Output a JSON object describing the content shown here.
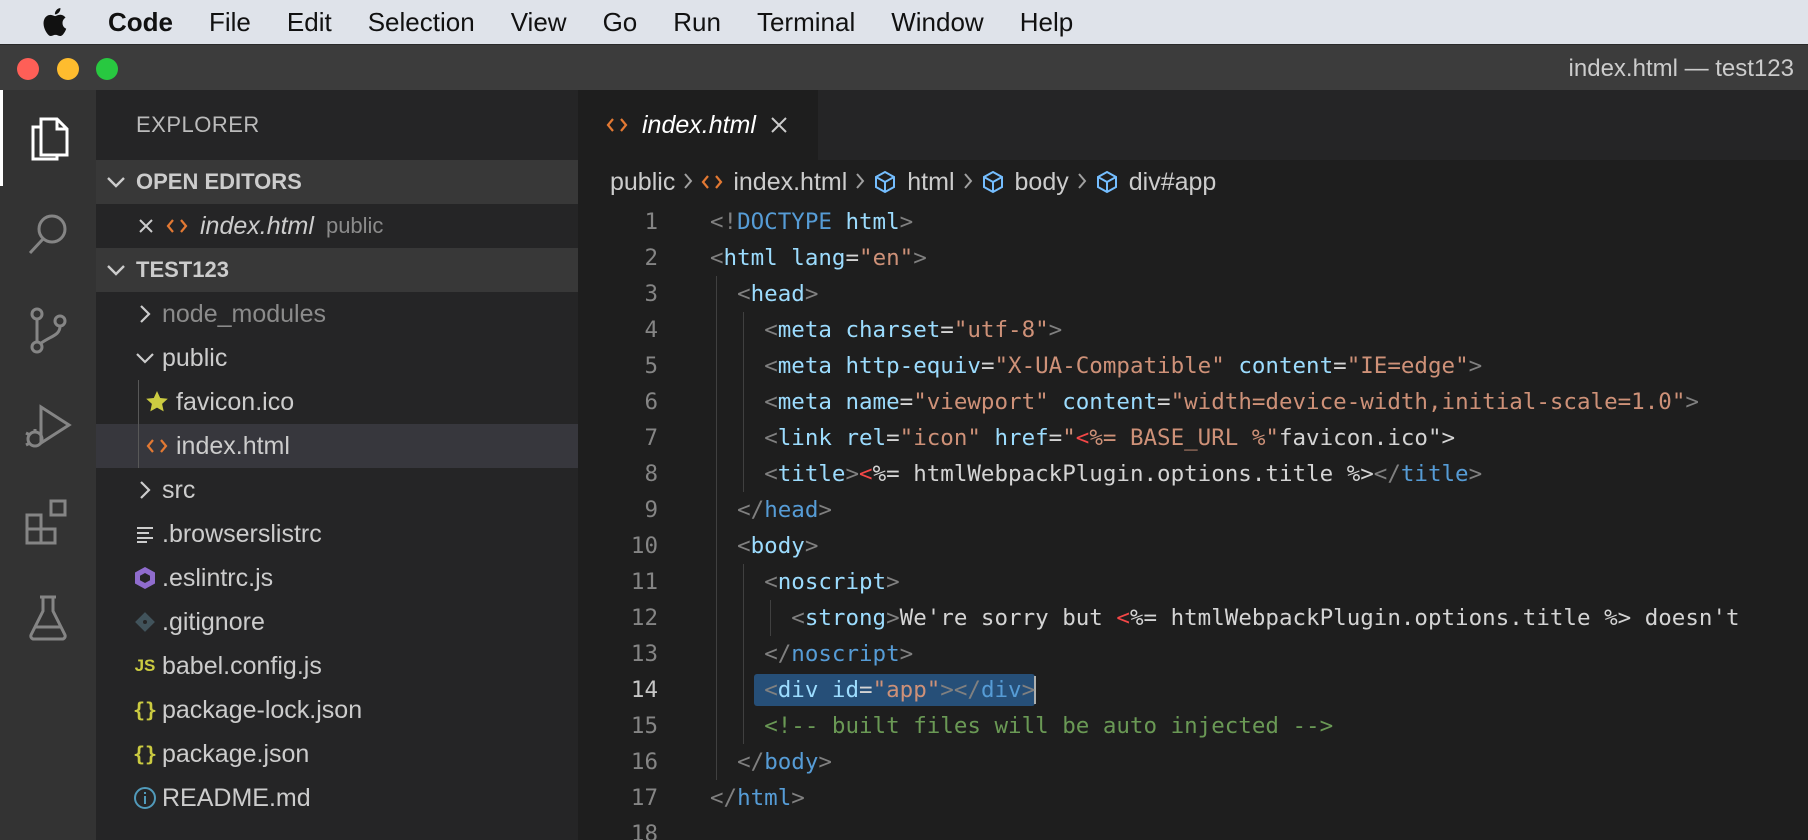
{
  "menubar": {
    "app_name": "Code",
    "items": [
      "File",
      "Edit",
      "Selection",
      "View",
      "Go",
      "Run",
      "Terminal",
      "Window",
      "Help"
    ]
  },
  "window": {
    "title": "index.html — test123"
  },
  "activity_bar": {
    "items": [
      "explorer-icon",
      "search-icon",
      "source-control-icon",
      "run-debug-icon",
      "extensions-icon",
      "testing-icon"
    ],
    "active": "explorer-icon"
  },
  "sidebar": {
    "title": "EXPLORER",
    "open_editors": {
      "header": "OPEN EDITORS",
      "items": [
        {
          "name": "index.html",
          "folder": "public"
        }
      ]
    },
    "project": {
      "header": "TEST123",
      "items": [
        {
          "label": "node_modules",
          "kind": "folder",
          "state": "collapsed",
          "icon": "chevron-right-icon",
          "dimmed": true
        },
        {
          "label": "public",
          "kind": "folder",
          "state": "expanded",
          "icon": "chevron-down-icon"
        },
        {
          "label": "favicon.ico",
          "kind": "file",
          "icon": "star-icon"
        },
        {
          "label": "index.html",
          "kind": "file",
          "icon": "html-icon",
          "selected": true
        },
        {
          "label": "src",
          "kind": "folder",
          "state": "collapsed",
          "icon": "chevron-right-icon"
        },
        {
          "label": ".browserslistrc",
          "kind": "file",
          "icon": "lines-icon"
        },
        {
          "label": ".eslintrc.js",
          "kind": "file",
          "icon": "eslint-icon"
        },
        {
          "label": ".gitignore",
          "kind": "file",
          "icon": "git-icon"
        },
        {
          "label": "babel.config.js",
          "kind": "file",
          "icon": "js-icon"
        },
        {
          "label": "package-lock.json",
          "kind": "file",
          "icon": "json-icon"
        },
        {
          "label": "package.json",
          "kind": "file",
          "icon": "json-icon"
        },
        {
          "label": "README.md",
          "kind": "file",
          "icon": "info-icon"
        }
      ]
    }
  },
  "editor": {
    "tab": {
      "label": "index.html",
      "close_symbol": "✕"
    },
    "breadcrumbs": [
      "public",
      "index.html",
      "html",
      "body",
      "div#app"
    ],
    "cursor_line": 14,
    "lines": [
      {
        "n": "1",
        "text": "<!DOCTYPE html>"
      },
      {
        "n": "2",
        "text": "<html lang=\"en\">"
      },
      {
        "n": "3",
        "text": "  <head>"
      },
      {
        "n": "4",
        "text": "    <meta charset=\"utf-8\">"
      },
      {
        "n": "5",
        "text": "    <meta http-equiv=\"X-UA-Compatible\" content=\"IE=edge\">"
      },
      {
        "n": "6",
        "text": "    <meta name=\"viewport\" content=\"width=device-width,initial-scale=1.0\">"
      },
      {
        "n": "7",
        "text": "    <link rel=\"icon\" href=\"<%= BASE_URL %>favicon.ico\">"
      },
      {
        "n": "8",
        "text": "    <title><%= htmlWebpackPlugin.options.title %></title>"
      },
      {
        "n": "9",
        "text": "  </head>"
      },
      {
        "n": "10",
        "text": "  <body>"
      },
      {
        "n": "11",
        "text": "    <noscript>"
      },
      {
        "n": "12",
        "text": "      <strong>We're sorry but <%= htmlWebpackPlugin.options.title %> doesn't"
      },
      {
        "n": "13",
        "text": "    </noscript>"
      },
      {
        "n": "14",
        "text": "    <div id=\"app\"></div>"
      },
      {
        "n": "15",
        "text": "    <!-- built files will be auto injected -->"
      },
      {
        "n": "16",
        "text": "  </body>"
      },
      {
        "n": "17",
        "text": "</html>"
      },
      {
        "n": "18",
        "text": ""
      }
    ]
  },
  "colors": {
    "tag": "#569cd6",
    "attribute": "#9cdcfe",
    "string": "#ce9178",
    "comment": "#6a9955",
    "ejs_delimiter": "#f44747",
    "selection": "#264f78",
    "html_icon": "#e37933",
    "json_icon": "#cbcb41",
    "breadcrumb_symbol": "#75beff"
  }
}
